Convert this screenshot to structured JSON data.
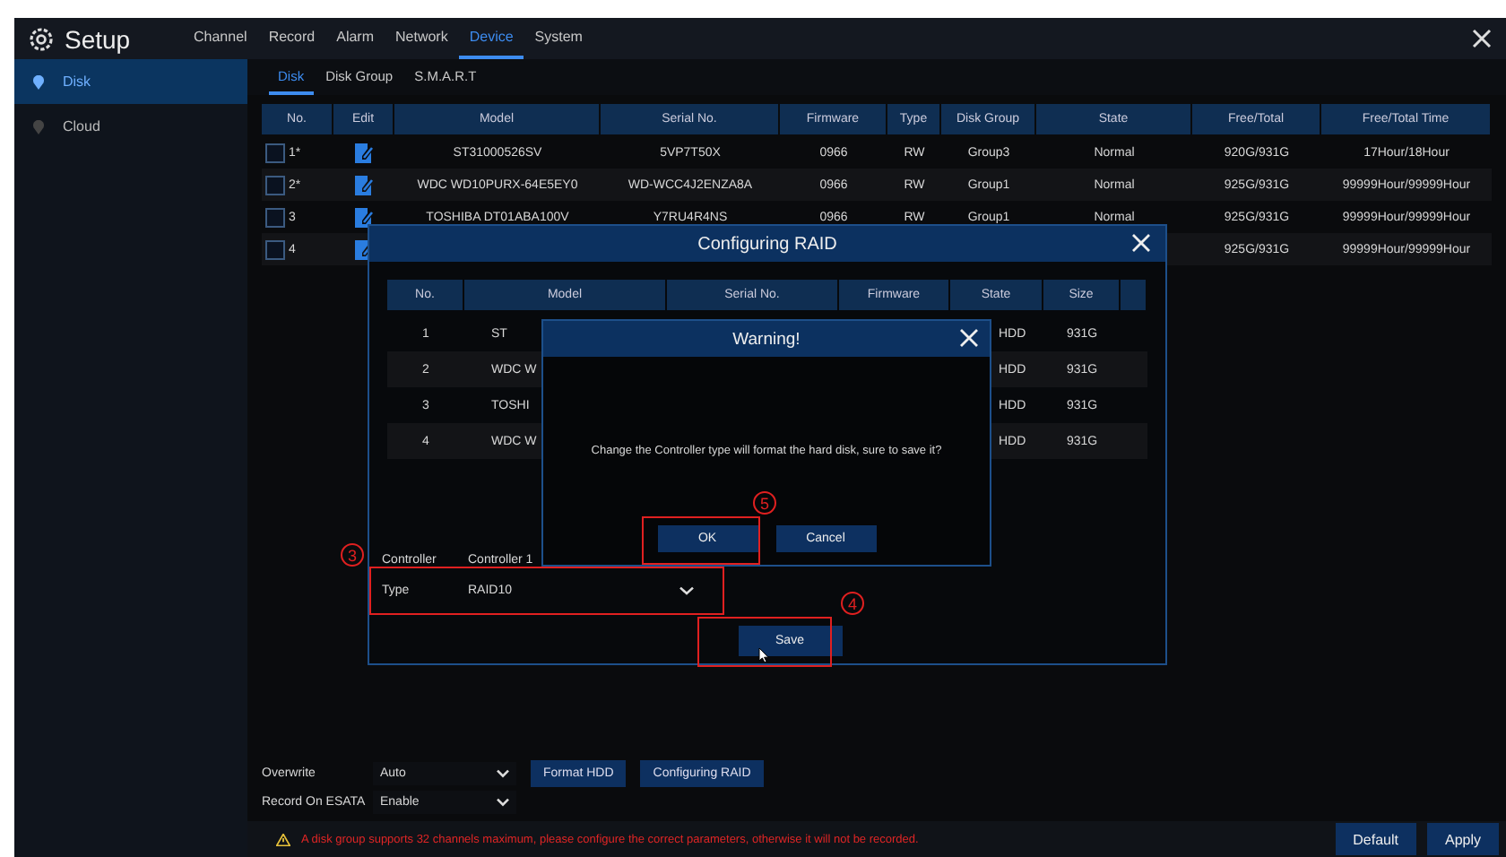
{
  "window": {
    "title": "Setup"
  },
  "tabs": [
    {
      "label": "Channel",
      "selected": false
    },
    {
      "label": "Record",
      "selected": false
    },
    {
      "label": "Alarm",
      "selected": false
    },
    {
      "label": "Network",
      "selected": false
    },
    {
      "label": "Device",
      "selected": true
    },
    {
      "label": "System",
      "selected": false
    }
  ],
  "sidebar": {
    "items": [
      {
        "label": "Disk",
        "selected": true
      },
      {
        "label": "Cloud",
        "selected": false
      }
    ]
  },
  "subtabs": [
    {
      "label": "Disk",
      "selected": true
    },
    {
      "label": "Disk Group",
      "selected": false
    },
    {
      "label": "S.M.A.R.T",
      "selected": false
    }
  ],
  "disk_table": {
    "columns": [
      "No.",
      "Edit",
      "Model",
      "Serial No.",
      "Firmware",
      "Type",
      "Disk Group",
      "State",
      "Free/Total",
      "Free/Total Time"
    ],
    "rows": [
      {
        "checked": false,
        "cells": [
          "1*",
          "",
          "ST31000526SV",
          "5VP7T50X",
          "0966",
          "RW",
          "Group3",
          "Normal",
          "920G/931G",
          "17Hour/18Hour"
        ]
      },
      {
        "checked": false,
        "cells": [
          "2*",
          "",
          "WDC WD10PURX-64E5EY0",
          "WD-WCC4J2ENZA8A",
          "0966",
          "RW",
          "Group1",
          "Normal",
          "925G/931G",
          "99999Hour/99999Hour"
        ]
      },
      {
        "checked": false,
        "cells": [
          "3",
          "",
          "TOSHIBA DT01ABA100V",
          "Y7RU4R4NS",
          "0966",
          "RW",
          "Group1",
          "Normal",
          "925G/931G",
          "99999Hour/99999Hour"
        ]
      },
      {
        "checked": false,
        "cells": [
          "4",
          "",
          null,
          null,
          null,
          null,
          null,
          null,
          "925G/931G",
          "99999Hour/99999Hour"
        ]
      }
    ]
  },
  "settings": [
    {
      "label": "Overwrite",
      "value": "Auto"
    },
    {
      "label": "Record On ESATA",
      "value": "Enable"
    }
  ],
  "action_buttons": [
    "Format HDD",
    "Configuring RAID"
  ],
  "footer": {
    "warning": "A disk group supports 32 channels maximum, please configure the correct parameters, otherwise it will not be recorded.",
    "buttons": [
      "Default",
      "Apply"
    ]
  },
  "raid_dialog": {
    "title": "Configuring RAID",
    "columns": [
      "No.",
      "Model",
      "Serial No.",
      "Firmware",
      "State",
      "Size"
    ],
    "rows": [
      [
        "1",
        "ST",
        "HDD",
        "931G"
      ],
      [
        "2",
        "WDC W",
        "HDD",
        "931G"
      ],
      [
        "3",
        "TOSHI",
        "HDD",
        "931G"
      ],
      [
        "4",
        "WDC W",
        "HDD",
        "931G"
      ]
    ],
    "controller_label": "Controller",
    "controller_value": "Controller 1",
    "type_label": "Type",
    "type_value": "RAID10",
    "save": "Save"
  },
  "warning_dialog": {
    "title": "Warning!",
    "message": "Change the Controller type will format the hard disk, sure to save it?",
    "buttons": [
      "OK",
      "Cancel"
    ]
  },
  "annotations": [
    "5",
    "3",
    "4"
  ]
}
